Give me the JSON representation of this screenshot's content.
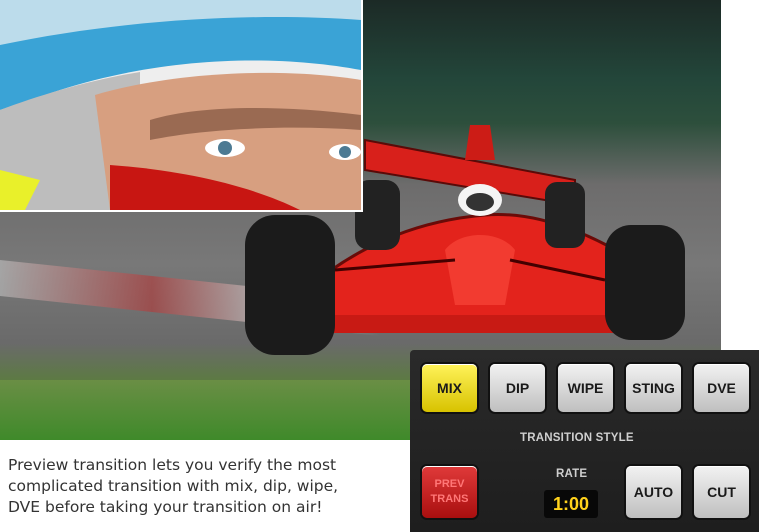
{
  "caption": {
    "line1": "Preview transition lets you verify the most",
    "line2": "complicated transition with mix, dip, wipe,",
    "line3": "DVE before taking your transition on air!"
  },
  "panel": {
    "style_buttons": [
      {
        "label": "MIX",
        "active": true
      },
      {
        "label": "DIP",
        "active": false
      },
      {
        "label": "WIPE",
        "active": false
      },
      {
        "label": "STING",
        "active": false
      },
      {
        "label": "DVE",
        "active": false
      }
    ],
    "transition_style_label": "TRANSITION STYLE",
    "prev_trans": {
      "line1": "PREV",
      "line2": "TRANS"
    },
    "rate_label": "RATE",
    "rate_value": "1:00",
    "auto_label": "AUTO",
    "cut_label": "CUT"
  },
  "colors": {
    "active": "#f2e21f",
    "prev_trans": "#c41d1d",
    "rate_text": "#ffd21c",
    "panel_bg": "#242424"
  }
}
